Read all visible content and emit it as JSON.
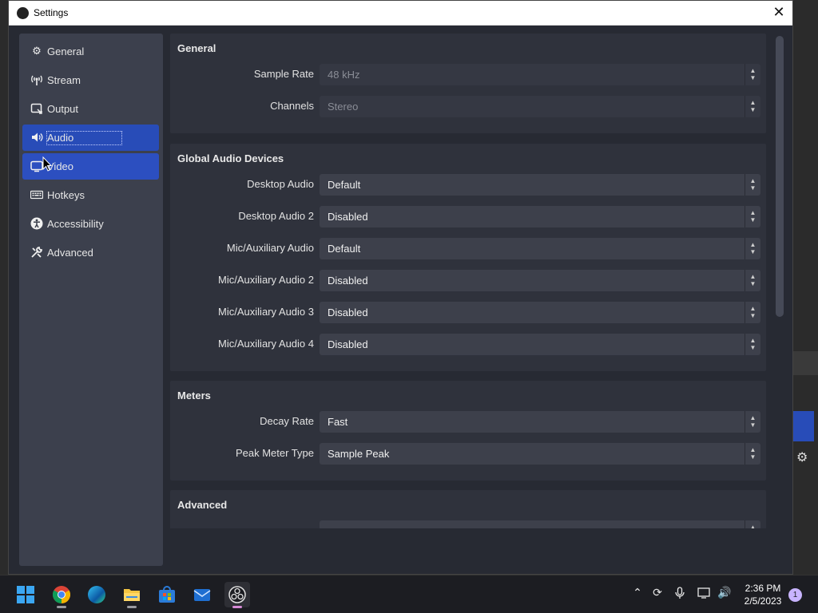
{
  "window": {
    "title": "Settings",
    "close_glyph": "✕"
  },
  "sidebar": {
    "items": [
      {
        "label": "General",
        "icon": "gear-icon"
      },
      {
        "label": "Stream",
        "icon": "antenna-icon"
      },
      {
        "label": "Output",
        "icon": "output-icon"
      },
      {
        "label": "Audio",
        "icon": "speaker-icon"
      },
      {
        "label": "Video",
        "icon": "monitor-icon"
      },
      {
        "label": "Hotkeys",
        "icon": "keyboard-icon"
      },
      {
        "label": "Accessibility",
        "icon": "accessibility-icon"
      },
      {
        "label": "Advanced",
        "icon": "tools-icon"
      }
    ],
    "selected": "Audio"
  },
  "sections": {
    "general": {
      "title": "General",
      "rows": [
        {
          "label": "Sample Rate",
          "value": "48 kHz"
        },
        {
          "label": "Channels",
          "value": "Stereo"
        }
      ]
    },
    "global_audio": {
      "title": "Global Audio Devices",
      "rows": [
        {
          "label": "Desktop Audio",
          "value": "Default"
        },
        {
          "label": "Desktop Audio 2",
          "value": "Disabled"
        },
        {
          "label": "Mic/Auxiliary Audio",
          "value": "Default"
        },
        {
          "label": "Mic/Auxiliary Audio 2",
          "value": "Disabled"
        },
        {
          "label": "Mic/Auxiliary Audio 3",
          "value": "Disabled"
        },
        {
          "label": "Mic/Auxiliary Audio 4",
          "value": "Disabled"
        }
      ]
    },
    "meters": {
      "title": "Meters",
      "rows": [
        {
          "label": "Decay Rate",
          "value": "Fast"
        },
        {
          "label": "Peak Meter Type",
          "value": "Sample Peak"
        }
      ]
    },
    "advanced": {
      "title": "Advanced"
    }
  },
  "taskbar": {
    "apps": [
      "windows-start",
      "chrome",
      "edge",
      "file-explorer",
      "microsoft-store",
      "mail",
      "obs-studio"
    ],
    "time": "2:36 PM",
    "date": "2/5/2023",
    "notification_count": "1"
  },
  "colors": {
    "accent": "#284cb8",
    "window_bg": "#272a33",
    "sidebar_bg": "#3c404d"
  }
}
